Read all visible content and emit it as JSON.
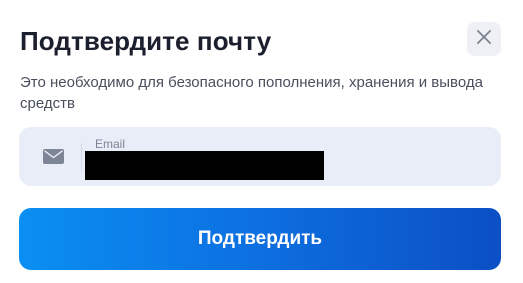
{
  "dialog": {
    "title": "Подтвердите почту",
    "subtitle": "Это необходимо для безопасного пополнения, хранения и вывода средств",
    "close_icon": "close-icon"
  },
  "email_field": {
    "icon": "mail-icon",
    "label": "Email",
    "value": ""
  },
  "confirm_button": {
    "label": "Подтвердить"
  },
  "colors": {
    "title": "#1c1f2e",
    "field_bg": "#e9edf7",
    "button_gradient_start": "#0a8ff2",
    "button_gradient_end": "#0b4fc4"
  }
}
